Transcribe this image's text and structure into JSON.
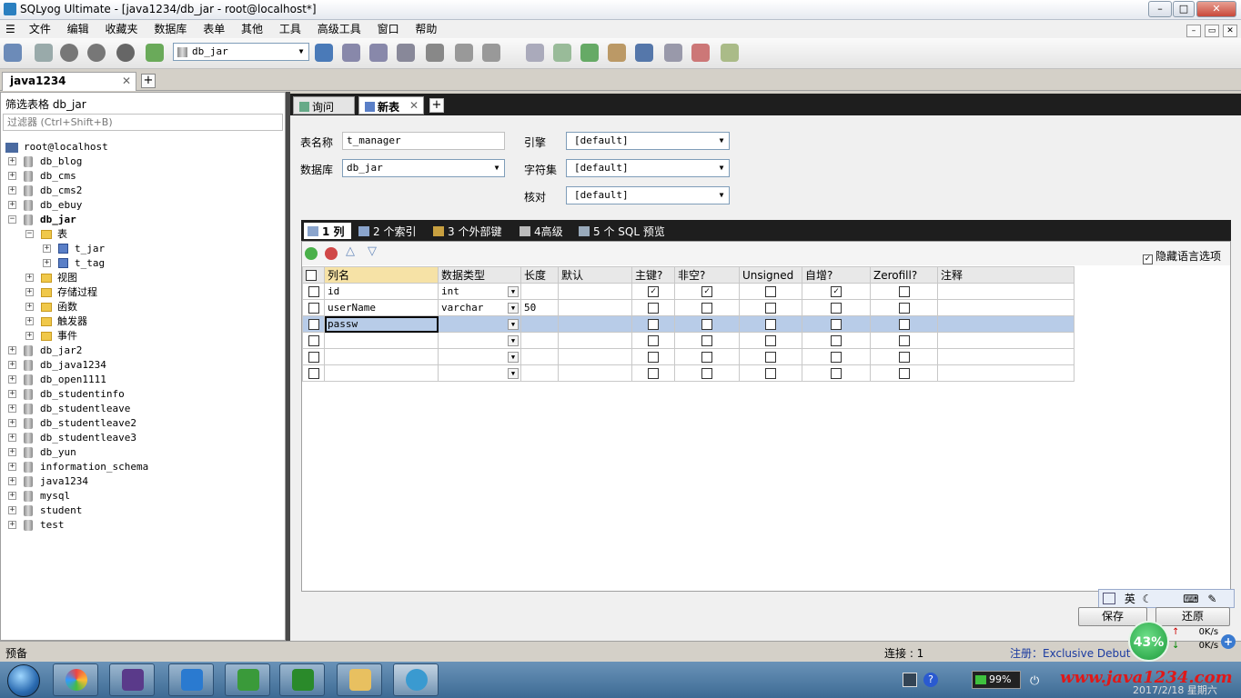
{
  "window": {
    "title": "SQLyog Ultimate - [java1234/db_jar - root@localhost*]",
    "controls": [
      "–",
      "□",
      "✕"
    ],
    "mdi_controls": [
      "–",
      "▭",
      "✕"
    ]
  },
  "menu": [
    "文件",
    "编辑",
    "收藏夹",
    "数据库",
    "表单",
    "其他",
    "工具",
    "高级工具",
    "窗口",
    "帮助"
  ],
  "toolbar": {
    "db_selector": "db_jar"
  },
  "connection_tab": {
    "label": "java1234",
    "close": "✕",
    "add": "+"
  },
  "object_browser": {
    "filter_label": "筛选表格 db_jar",
    "filter_placeholder": "过滤器 (Ctrl+Shift+B)",
    "root": "root@localhost",
    "databases_before": [
      "db_blog",
      "db_cms",
      "db_cms2",
      "db_ebuy"
    ],
    "current_db": "db_jar",
    "folder_tables": "表",
    "tables": [
      "t_jar",
      "t_tag"
    ],
    "folders": [
      "视图",
      "存储过程",
      "函数",
      "触发器",
      "事件"
    ],
    "databases_after": [
      "db_jar2",
      "db_java1234",
      "db_open1111",
      "db_studentinfo",
      "db_studentleave",
      "db_studentleave2",
      "db_studentleave3",
      "db_yun",
      "information_schema",
      "java1234",
      "mysql",
      "student",
      "test"
    ]
  },
  "query_tabs": {
    "query": "询问",
    "new_table": "新表",
    "close": "✕",
    "add": "+"
  },
  "table_form": {
    "name_label": "表名称",
    "name_value": "t_manager",
    "db_label": "数据库",
    "db_value": "db_jar",
    "engine_label": "引擎",
    "engine_value": "[default]",
    "charset_label": "字符集",
    "charset_value": "[default]",
    "collation_label": "核对",
    "collation_value": "[default]"
  },
  "sub_tabs": [
    "1 列",
    "2 个索引",
    "3 个外部键",
    "4高级",
    "5 个 SQL 预览"
  ],
  "hide_language_options": "隐藏语言选项",
  "grid": {
    "headers": [
      "列名",
      "数据类型",
      "长度",
      "默认",
      "主键?",
      "非空?",
      "Unsigned",
      "自增?",
      "Zerofill?",
      "注释"
    ],
    "rows": [
      {
        "name": "id",
        "type": "int",
        "length": "",
        "pk": true,
        "nn": true,
        "unsigned": false,
        "ai": true,
        "zf": false
      },
      {
        "name": "userName",
        "type": "varchar",
        "length": "50",
        "pk": false,
        "nn": false,
        "unsigned": false,
        "ai": false,
        "zf": false
      },
      {
        "name": "passw",
        "type": "",
        "length": "",
        "pk": false,
        "nn": false,
        "unsigned": false,
        "ai": false,
        "zf": false
      },
      {
        "name": "",
        "type": "",
        "length": "",
        "pk": false,
        "nn": false,
        "unsigned": false,
        "ai": false,
        "zf": false
      },
      {
        "name": "",
        "type": "",
        "length": "",
        "pk": false,
        "nn": false,
        "unsigned": false,
        "ai": false,
        "zf": false
      },
      {
        "name": "",
        "type": "",
        "length": "",
        "pk": false,
        "nn": false,
        "unsigned": false,
        "ai": false,
        "zf": false
      }
    ]
  },
  "buttons": {
    "save": "保存",
    "revert": "还原"
  },
  "ime": {
    "lang": "英"
  },
  "status": {
    "left": "预备",
    "connections": "连接 : 1",
    "registration": "注册：Exclusive Debut"
  },
  "net": {
    "percent": "43%",
    "up": "0K/s",
    "down": "0K/s"
  },
  "taskbar": {
    "battery": "99%",
    "watermark": "www.java1234.com",
    "date": "2017/2/18 星期六"
  },
  "colors": {
    "accent": "#2a7fc0",
    "selected_row": "#b8cce8",
    "header_highlight": "#f6e2a6",
    "watermark": "#e01818"
  }
}
